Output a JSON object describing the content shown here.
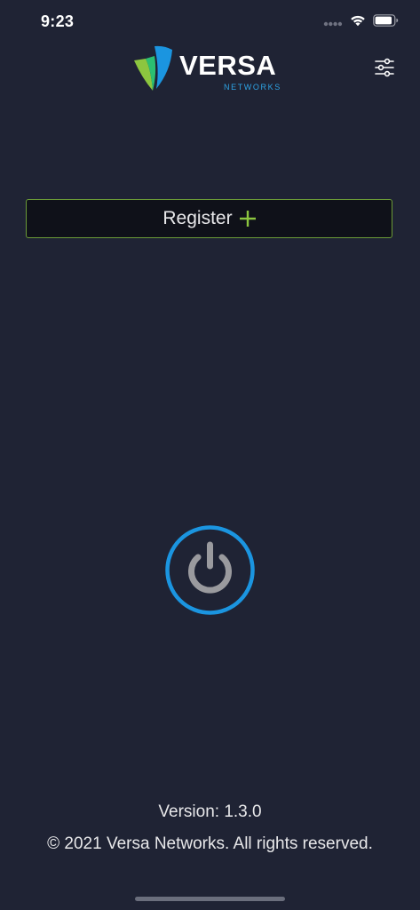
{
  "status_bar": {
    "time": "9:23",
    "signal_icon": "cellular-dots-icon",
    "wifi_icon": "wifi-icon",
    "battery_icon": "battery-icon",
    "battery_level": 0.9
  },
  "header": {
    "logo_text": "VERSA",
    "logo_subtext": "NETWORKS",
    "settings_icon": "sliders-icon"
  },
  "register": {
    "label": "Register",
    "icon": "plus-icon"
  },
  "power": {
    "icon": "power-icon"
  },
  "footer": {
    "version": "Version: 1.3.0",
    "copyright": "© 2021 Versa Networks. All rights reserved."
  },
  "colors": {
    "background": "#1f2334",
    "accent_green": "#8cc63f",
    "accent_blue": "#1b95e0",
    "register_border": "#6b9b37",
    "power_glyph": "#9a9a9e"
  }
}
